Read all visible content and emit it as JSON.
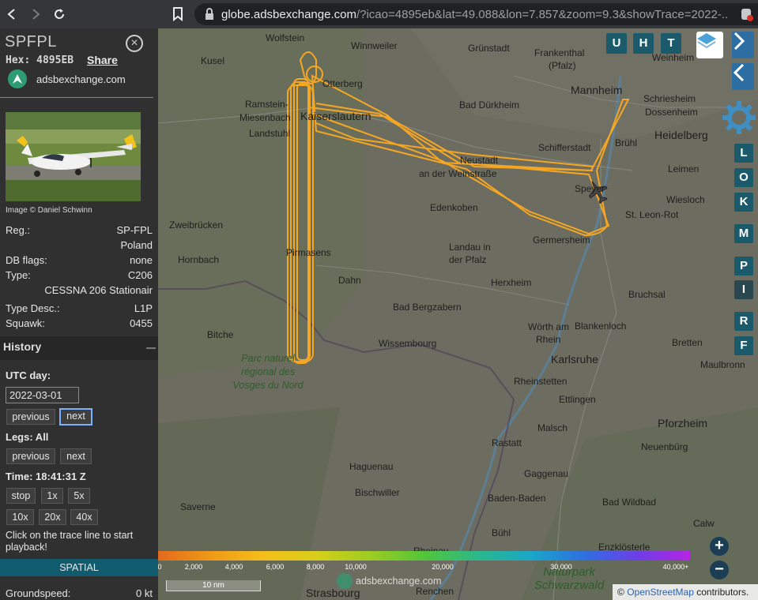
{
  "browser": {
    "url_host": "globe.adsbexchange.com",
    "url_path": "/?icao=4895eb&lat=49.088&lon=7.857&zoom=9.3&showTrace=2022-..."
  },
  "aircraft": {
    "callsign": "SPFPL",
    "hex_label": "Hex:",
    "hex": "4895EB",
    "share": "Share",
    "site": "adsbexchange.com",
    "photo_credit": "Image © Daniel Schwinn",
    "rows": [
      {
        "label": "Reg.:",
        "value": "SP-FPL"
      },
      {
        "label": "",
        "value": "Poland"
      },
      {
        "label": "DB flags:",
        "value": "none"
      },
      {
        "label": "Type:",
        "value": "C206"
      },
      {
        "label": "",
        "value": "CESSNA 206 Stationair"
      },
      {
        "label": "Type Desc.:",
        "value": "L1P"
      },
      {
        "label": "Squawk:",
        "value": "0455"
      }
    ]
  },
  "history": {
    "header": "History",
    "utc_day_label": "UTC day:",
    "date": "2022-03-01",
    "previous": "previous",
    "next": "next",
    "legs_label": "Legs: All",
    "time_label": "Time: 18:41:31 Z",
    "speed_buttons": [
      "stop",
      "1x",
      "5x",
      "10x",
      "20x",
      "40x"
    ],
    "hint": "Click on the trace line to start playback!",
    "spatial": "SPATIAL",
    "groundspeed_label": "Groundspeed:",
    "groundspeed": "0 kt"
  },
  "map": {
    "places": [
      {
        "name": "Wolfstein",
        "cls": "place"
      },
      {
        "name": "Winnweiler",
        "cls": "place"
      },
      {
        "name": "Grünstadt",
        "cls": "place"
      },
      {
        "name": "Frankenthal",
        "cls": "place"
      },
      {
        "name": "(Pfalz)",
        "cls": "place"
      },
      {
        "name": "Weinheim",
        "cls": "place"
      },
      {
        "name": "Kusel",
        "cls": "place"
      },
      {
        "name": "Otterberg",
        "cls": "place"
      },
      {
        "name": "Mannheim",
        "cls": "place big"
      },
      {
        "name": "Ramstein-",
        "cls": "place"
      },
      {
        "name": "Miesenbach",
        "cls": "place"
      },
      {
        "name": "Kaiserslautern",
        "cls": "place big"
      },
      {
        "name": "Bad Dürkheim",
        "cls": "place"
      },
      {
        "name": "Schriesheim",
        "cls": "place"
      },
      {
        "name": "Dossenheim",
        "cls": "place"
      },
      {
        "name": "Landstuhl",
        "cls": "place"
      },
      {
        "name": "Heidelberg",
        "cls": "place big"
      },
      {
        "name": "Schifferstadt",
        "cls": "place"
      },
      {
        "name": "Brühl",
        "cls": "place"
      },
      {
        "name": "Neustadt",
        "cls": "place"
      },
      {
        "name": "an der Weinstraße",
        "cls": "place"
      },
      {
        "name": "Leimen",
        "cls": "place"
      },
      {
        "name": "Speyer",
        "cls": "place"
      },
      {
        "name": "Wiesloch",
        "cls": "place"
      },
      {
        "name": "Edenkoben",
        "cls": "place"
      },
      {
        "name": "Zweibrücken",
        "cls": "place"
      },
      {
        "name": "St. Leon-Rot",
        "cls": "place"
      },
      {
        "name": "Germersheim",
        "cls": "place"
      },
      {
        "name": "Pirmasens",
        "cls": "place"
      },
      {
        "name": "Landau in",
        "cls": "place"
      },
      {
        "name": "der Pfalz",
        "cls": "place"
      },
      {
        "name": "Hornbach",
        "cls": "place"
      },
      {
        "name": "Dahn",
        "cls": "place"
      },
      {
        "name": "Herxheim",
        "cls": "place"
      },
      {
        "name": "Bruchsal",
        "cls": "place"
      },
      {
        "name": "Bad Bergzabern",
        "cls": "place"
      },
      {
        "name": "Wörth am",
        "cls": "place"
      },
      {
        "name": "Rhein",
        "cls": "place"
      },
      {
        "name": "Blankenloch",
        "cls": "place"
      },
      {
        "name": "Bitche",
        "cls": "place"
      },
      {
        "name": "Wissembourg",
        "cls": "place"
      },
      {
        "name": "Bretten",
        "cls": "place"
      },
      {
        "name": "Karlsruhe",
        "cls": "place big"
      },
      {
        "name": "Maulbronn",
        "cls": "place"
      },
      {
        "name": "Rheinstetten",
        "cls": "place"
      },
      {
        "name": "Ettlingen",
        "cls": "place"
      },
      {
        "name": "Pforzheim",
        "cls": "place big"
      },
      {
        "name": "Malsch",
        "cls": "place"
      },
      {
        "name": "Haguenau",
        "cls": "place"
      },
      {
        "name": "Rastatt",
        "cls": "place"
      },
      {
        "name": "Neuenbürg",
        "cls": "place"
      },
      {
        "name": "Gaggenau",
        "cls": "place"
      },
      {
        "name": "Bischwiller",
        "cls": "place"
      },
      {
        "name": "Saverne",
        "cls": "place"
      },
      {
        "name": "Baden-Baden",
        "cls": "place"
      },
      {
        "name": "Bad Wildbad",
        "cls": "place"
      },
      {
        "name": "Bühl",
        "cls": "place"
      },
      {
        "name": "Calw",
        "cls": "place"
      },
      {
        "name": "Enzklösterle",
        "cls": "place"
      },
      {
        "name": "Rheinau",
        "cls": "place"
      },
      {
        "name": "Strasbourg",
        "cls": "place big"
      },
      {
        "name": "Renchen",
        "cls": "place"
      },
      {
        "name": "Parc naturel régional des Vosges du Nord",
        "cls": "place park"
      },
      {
        "name": "Naturpark Schwarzwald",
        "cls": "place park"
      }
    ],
    "toolbar_top": [
      "U",
      "H",
      "T"
    ],
    "toolbar_side": [
      "L",
      "O",
      "K",
      "M",
      "P",
      "I",
      "R",
      "F"
    ],
    "altitude_labels": [
      "0",
      "2,000",
      "4,000",
      "6,000",
      "8,000",
      "10,000",
      "20,000",
      "30,000",
      "40,000+"
    ],
    "altitude_colors": [
      "#e26a1c",
      "#ef9a17",
      "#f4bf1a",
      "#d6cf1b",
      "#9ccc22",
      "#52c53a",
      "#2bb88a",
      "#19a7c9",
      "#2e6fe0",
      "#6d3ee6",
      "#b524e2"
    ],
    "scale_label": "10 nm",
    "watermark": "adsbexchange.com",
    "attribution_prefix": "©",
    "attribution_link": "OpenStreetMap",
    "attribution_suffix": "contributors.",
    "zoom_in": "+",
    "zoom_out": "−",
    "trace_color": "#f5a623"
  }
}
